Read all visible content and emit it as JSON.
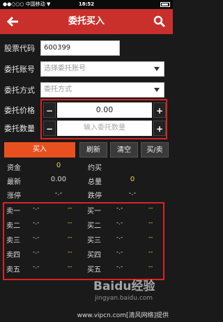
{
  "status_bar": {
    "carrier": "●●○○○ 中国移动 ▼",
    "time": "18:52"
  },
  "nav": {
    "title": "委托买入"
  },
  "form": {
    "stock_code_label": "股票代码",
    "stock_code_value": "600399",
    "account_label": "委托账号",
    "account_placeholder": "选择委托账号",
    "method_label": "委托方式",
    "method_placeholder": "委托方式",
    "price_label": "委托价格",
    "price_value": "0.00",
    "quantity_label": "委托数量",
    "quantity_placeholder": "输入委托数量",
    "minus": "−",
    "plus": "+"
  },
  "actions": {
    "buy": "买入",
    "refresh": "刷新",
    "clear": "清空",
    "buy_sell": "买/卖"
  },
  "info": {
    "funds_label": "资金",
    "funds_value": "0",
    "approx_buy_label": "约买",
    "approx_buy_value": "",
    "latest_label": "最新",
    "latest_value": "0.00",
    "total_label": "总量",
    "total_value": "0",
    "limit_up_label": "涨停",
    "limit_up_value": "-.-",
    "limit_down_label": "跌停",
    "limit_down_value": "-.-"
  },
  "quotes": {
    "sell": [
      {
        "label": "卖一",
        "price": "-.-",
        "vol": "--"
      },
      {
        "label": "卖二",
        "price": "-.-",
        "vol": "--"
      },
      {
        "label": "卖三",
        "price": "-.-",
        "vol": "--"
      },
      {
        "label": "卖四",
        "price": "-.-",
        "vol": "--"
      },
      {
        "label": "卖五",
        "price": "-.-",
        "vol": "--"
      }
    ],
    "buy": [
      {
        "label": "买一",
        "price": "-.-",
        "vol": "--"
      },
      {
        "label": "买二",
        "price": "-.-",
        "vol": "--"
      },
      {
        "label": "买三",
        "price": "-.-",
        "vol": "--"
      },
      {
        "label": "买四",
        "price": "-.-",
        "vol": "--"
      },
      {
        "label": "买五",
        "price": "-.-",
        "vol": "--"
      }
    ]
  },
  "watermark": {
    "brand": "Baidu经验",
    "url": "jingyan.baidu.com"
  },
  "footer": {
    "text": "www.vipcn.com[清风网络]提供"
  },
  "colors": {
    "nav_red": "#c9302c",
    "buy_orange": "#e8511f",
    "highlight_red": "#dd2222",
    "value_yellow": "#e8d34a"
  }
}
